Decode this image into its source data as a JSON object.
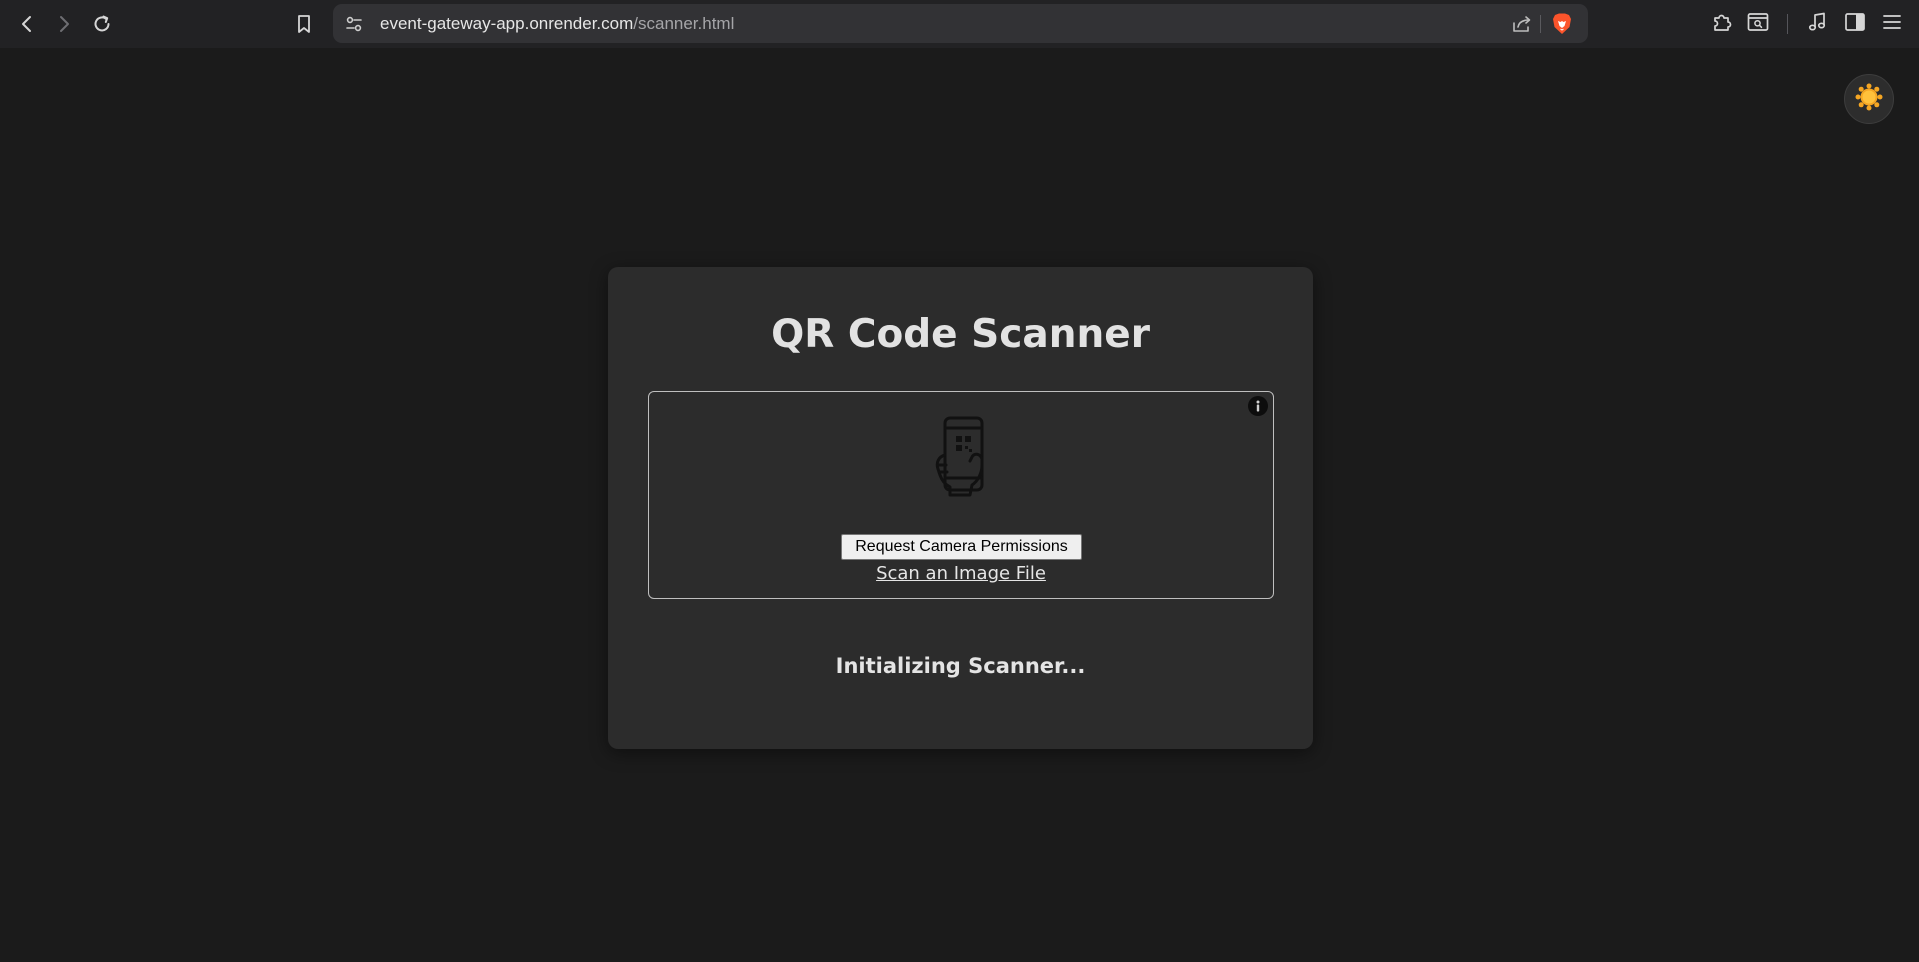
{
  "browser": {
    "url_host": "event-gateway-app.onrender.com",
    "url_path": "/scanner.html",
    "icons": {
      "back": "chevron-left-icon",
      "forward": "chevron-right-icon",
      "reload": "reload-icon",
      "bookmark": "bookmark-icon",
      "site_info": "site-settings-icon",
      "share": "share-icon",
      "brave_shields": "brave-lion-icon",
      "extensions": "puzzle-icon",
      "page_search": "page-search-icon",
      "media": "music-note-icon",
      "sidebar": "sidebar-icon",
      "menu": "hamburger-menu-icon"
    },
    "colors": {
      "brave_orange": "#fb542b"
    }
  },
  "page": {
    "theme_toggle_icon": "sun-icon",
    "theme_toggle_color": "#f5a623",
    "title": "QR Code Scanner",
    "reader": {
      "info_icon": "info-icon",
      "illustration_icon": "phone-qr-scan-icon",
      "permission_button_label": "Request Camera Permissions",
      "scan_file_link_label": "Scan an Image File"
    },
    "status": "Initializing Scanner..."
  }
}
